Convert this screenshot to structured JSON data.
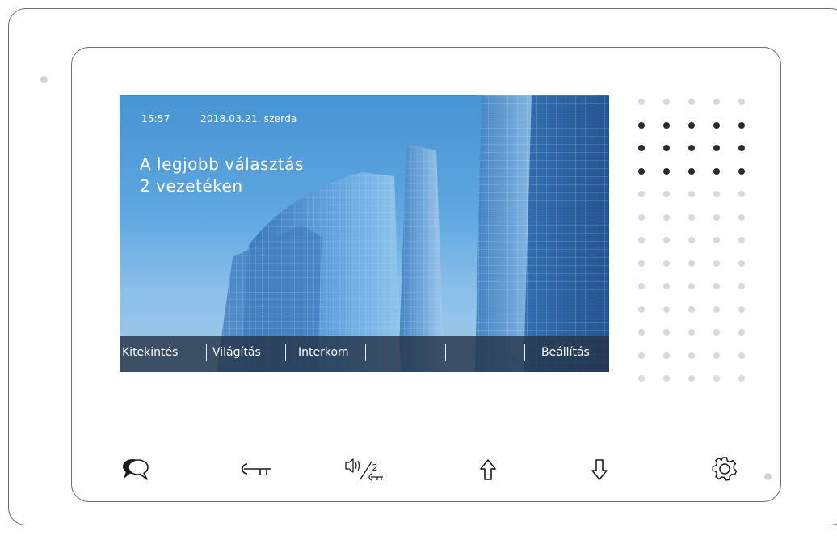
{
  "status": {
    "time": "15:57",
    "date": "2018.03.21. szerda"
  },
  "headline": {
    "line1": "A legjobb választás",
    "line2": "2 vezetéken"
  },
  "menu": {
    "items": [
      "Kitekintés",
      "Világítás",
      "Interkom",
      "",
      "",
      "Beállítás"
    ]
  },
  "buttons": {
    "icons": [
      "speech-bubble-icon",
      "key-icon",
      "speaker-key-icon",
      "arrow-up-icon",
      "arrow-down-icon",
      "gear-icon"
    ],
    "speaker_key_label": "2"
  },
  "colors": {
    "screen_sky": "#4a99da",
    "menubar": "#24344a",
    "frame": "#6d6d6d",
    "grille_dark": "#2b2b2b",
    "grille_light": "#d9d9d9"
  }
}
